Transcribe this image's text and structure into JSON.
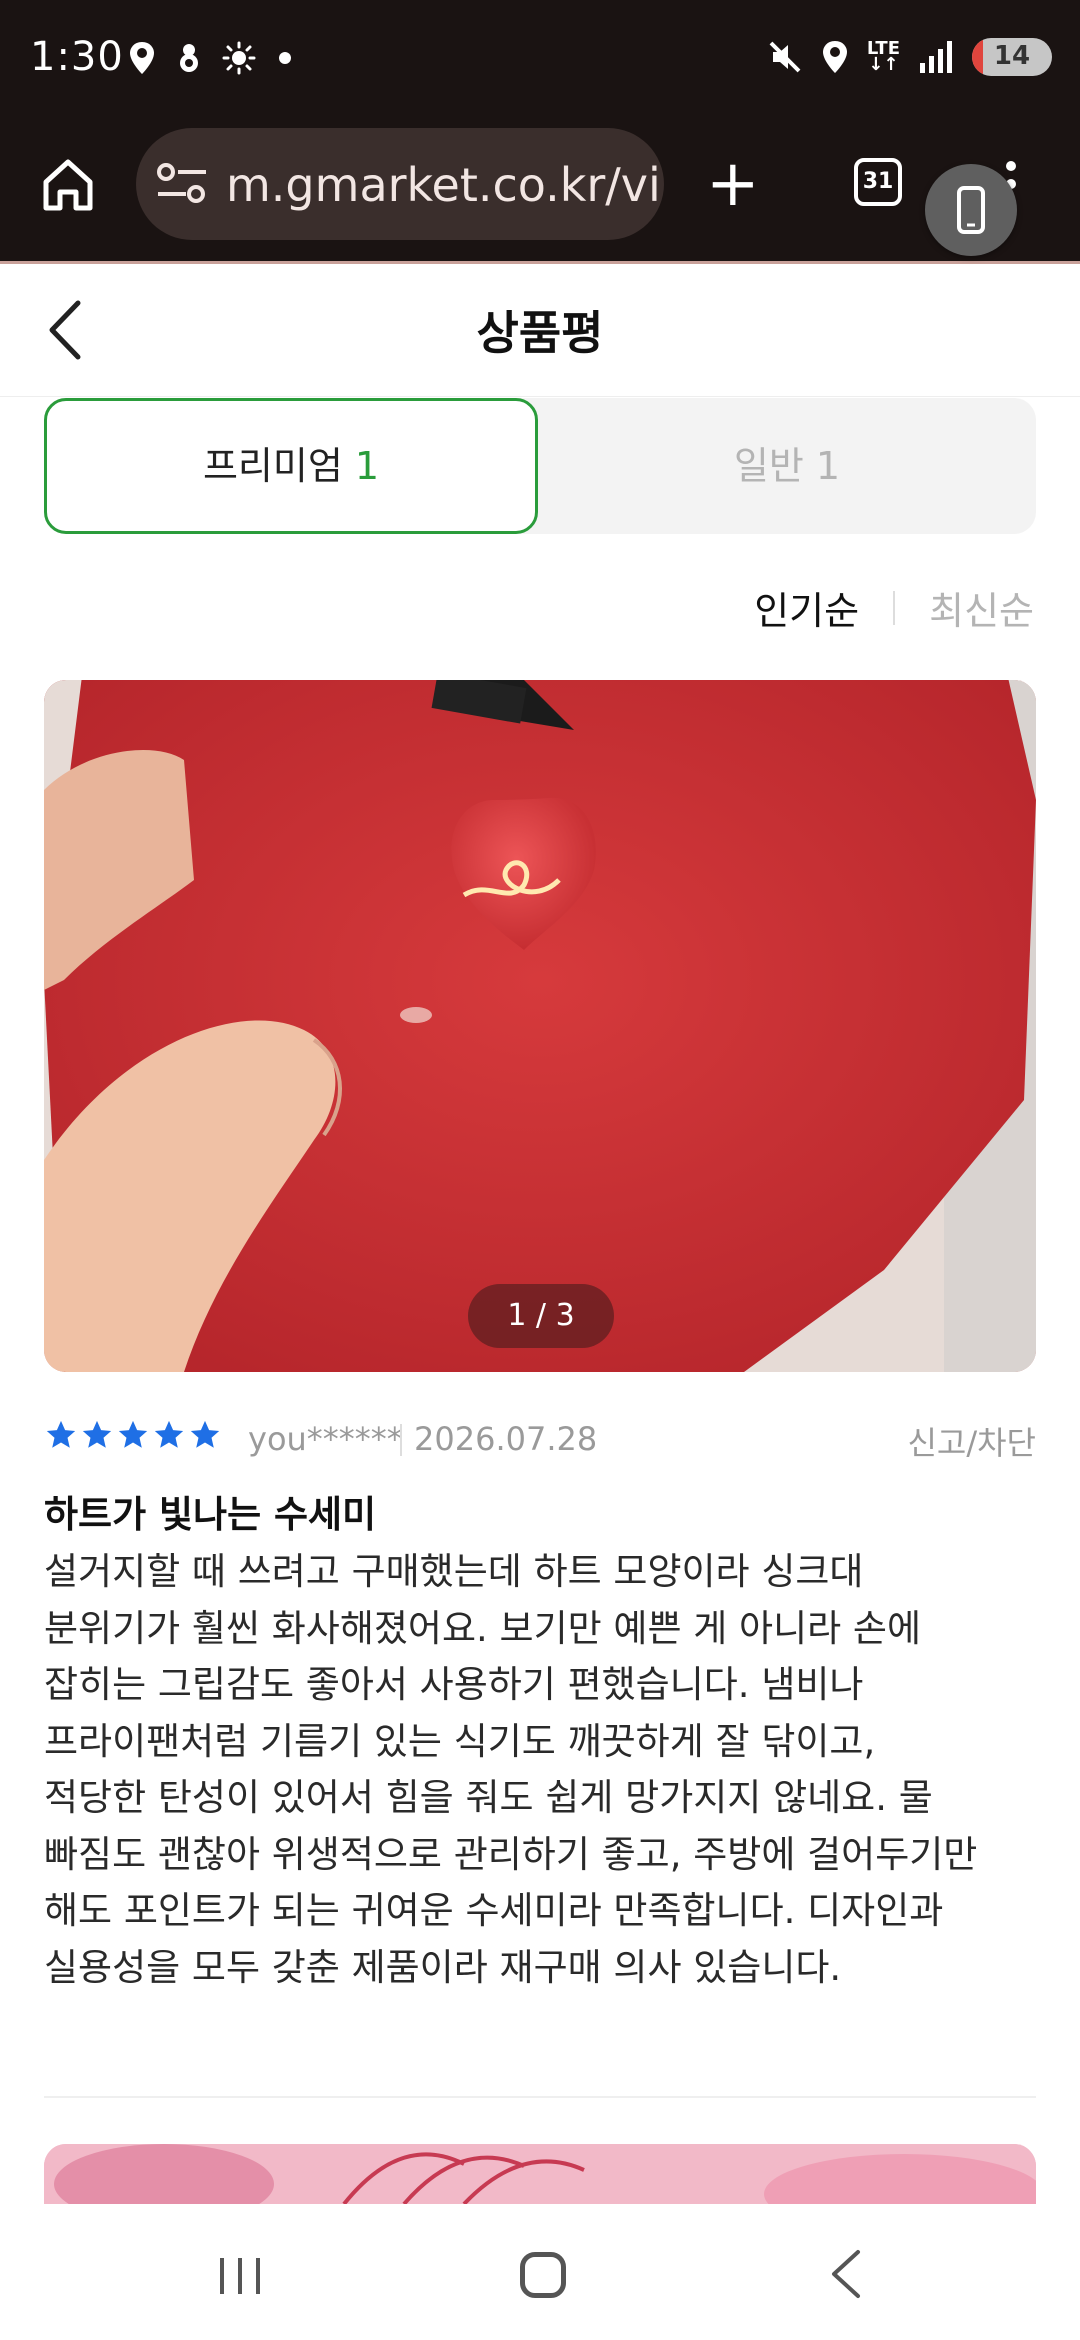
{
  "status_bar": {
    "time": "1:30",
    "network": "LTE",
    "battery": "14",
    "battery_level_percent": 14
  },
  "browser": {
    "url": "m.gmarket.co.kr/vi",
    "tab_count": "31",
    "icons": [
      "home-icon",
      "site-settings-icon",
      "new-tab-icon",
      "tab-switcher-icon",
      "more-menu-icon",
      "device-icon"
    ]
  },
  "header": {
    "title": "상품평"
  },
  "tabs": {
    "premium_label": "프리미엄",
    "premium_count": "1",
    "general_label": "일반",
    "general_count": "1"
  },
  "sort": {
    "popular": "인기순",
    "newest": "최신순"
  },
  "review": {
    "image_counter": "1 / 3",
    "rating": 5,
    "user": "you******",
    "date": "2026.07.28",
    "report": "신고/차단",
    "title": "하트가 빛나는 수세미",
    "body": "설거지할 때 쓰려고 구매했는데 하트 모양이라 싱크대 분위기가 훨씬 화사해졌어요. 보기만 예쁜 게 아니라 손에 잡히는 그립감도 좋아서 사용하기 편했습니다. 냄비나 프라이팬처럼 기름기 있는 식기도 깨끗하게 잘 닦이고, 적당한 탄성이 있어서 힘을 줘도 쉽게 망가지지 않네요. 물 빠짐도 괜찮아 위생적으로 관리하기 좋고, 주방에 걸어두기만 해도 포인트가 되는 귀여운 수세미라 만족합니다. 디자인과 실용성을 모두 갖춘 제품이라 재구매 의사 있습니다."
  },
  "colors": {
    "accent_green": "#2a9c3b",
    "star_blue": "#1f6fe5",
    "browser_bg": "#1a1312"
  }
}
